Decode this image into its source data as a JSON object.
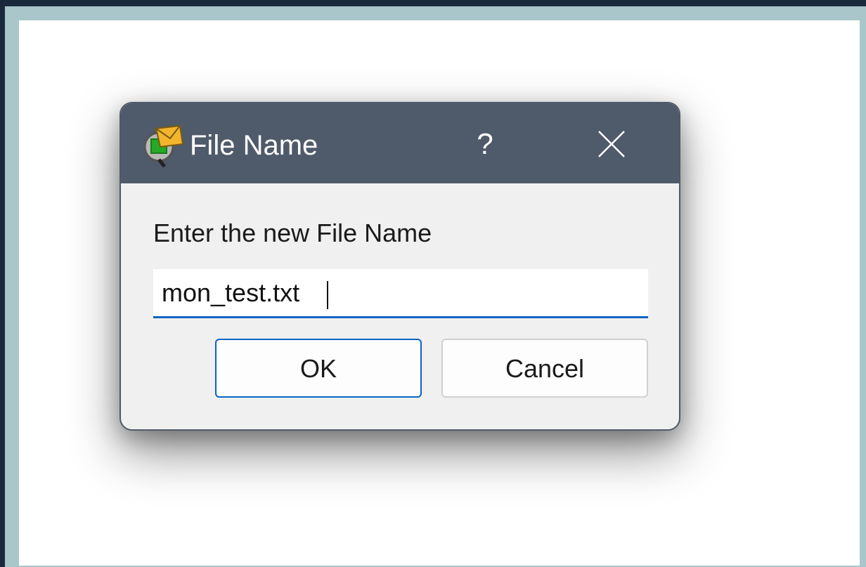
{
  "dialog": {
    "title": "File Name",
    "help_label": "?",
    "icons": {
      "app": "magnifier-envelope-icon",
      "close": "close-icon"
    },
    "prompt": "Enter the new File Name",
    "input_value": "mon_test.txt",
    "ok_label": "OK",
    "cancel_label": "Cancel"
  },
  "colors": {
    "titlebar": "#4f5a6a",
    "accent": "#0a64c4",
    "dialog_body": "#f0f0f0",
    "outer_border": "#a9c7cb",
    "outer_background": "#1b2a3a"
  }
}
